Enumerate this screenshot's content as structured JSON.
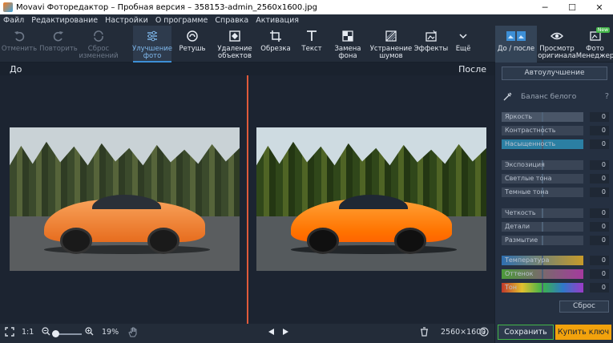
{
  "titlebar": {
    "title": "Movavi Фоторедактор – Пробная версия – 358153-admin_2560x1600.jpg",
    "minimize": "─",
    "maximize": "☐",
    "close": "✕"
  },
  "menu": [
    "Файл",
    "Редактирование",
    "Настройки",
    "О программе",
    "Справка",
    "Активация"
  ],
  "toolbar": {
    "undo": "Отменить",
    "redo": "Повторить",
    "reset": "Сброс\nизменений",
    "enhance": "Улучшение\nфото",
    "retouch": "Ретушь",
    "remove_objects": "Удаление\nобъектов",
    "crop": "Обрезка",
    "text": "Текст",
    "bg_replace": "Замена\nфона",
    "denoise": "Устранение\nшумов",
    "effects": "Эффекты",
    "more": "Ещё",
    "before_after": "До / после",
    "view_original": "Просмотр\nоригинала",
    "photo_manager": "Фото\nМенеджер",
    "new_badge": "New"
  },
  "view": {
    "before_label": "До",
    "after_label": "После"
  },
  "bottombar": {
    "zoom_ratio": "1:1",
    "zoom_percent": "19%",
    "dimensions": "2560×1600"
  },
  "panel": {
    "auto_enhance": "Автоулучшение",
    "white_balance": "Баланс белого",
    "help": "?",
    "sliders": [
      {
        "label": "Яркость",
        "value": "0",
        "fill_color": "#4a5668",
        "level": 1.0
      },
      {
        "label": "Контрастность",
        "value": "0",
        "fill_color": "#3a4556",
        "level": 0.0
      },
      {
        "label": "Насыщенность",
        "value": "0",
        "fill_color": "#2b7fa3",
        "level": 1.0
      },
      {
        "label": "Экспозиция",
        "value": "0",
        "fill_color": "#3a4556",
        "level": 0.0
      },
      {
        "label": "Светлые тона",
        "value": "0",
        "fill_color": "#3a4556",
        "level": 0.0
      },
      {
        "label": "Темные тона",
        "value": "0",
        "fill_color": "#3a4556",
        "level": 0.0
      },
      {
        "label": "Четкость",
        "value": "0",
        "fill_color": "#3a4556",
        "level": 0.0
      },
      {
        "label": "Детали",
        "value": "0",
        "fill_color": "#3a4556",
        "level": 0.0
      },
      {
        "label": "Размытие",
        "value": "0",
        "fill_color": "#3a4556",
        "level": 0.0
      },
      {
        "label": "Температура",
        "value": "0",
        "fill_color": "linear-gradient(90deg,#2f6fb0,#c79b2a)",
        "level": 1.0
      },
      {
        "label": "Оттенок",
        "value": "0",
        "fill_color": "linear-gradient(90deg,#4c9a3a,#a53a9e)",
        "level": 1.0
      },
      {
        "label": "Тон",
        "value": "0",
        "fill_color": "linear-gradient(90deg,#c0392b,#e2c12f,#3bb34a,#2f78c8,#9b3bc8)",
        "level": 1.0
      }
    ],
    "reset": "Сброс",
    "save": "Сохранить",
    "buy": "Купить ключ"
  }
}
